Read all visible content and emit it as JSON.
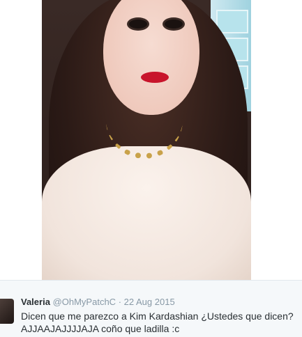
{
  "tweet": {
    "display_name": "Valeria",
    "handle": "@OhMyPatchC",
    "separator": "·",
    "date": "22 Aug 2015",
    "text_line1": "Dicen que me parezco a Kim Kardashian ¿Ustedes que dicen?",
    "text_line2": "AJJAAJAJJJJAJA coño que ladilla :c"
  },
  "colors": {
    "background": "#f5f8fa",
    "name": "#292f33",
    "meta": "#8899a6",
    "lips": "#c8142b"
  },
  "icons": [
    "user-avatar-image",
    "tweet-photo-image"
  ]
}
